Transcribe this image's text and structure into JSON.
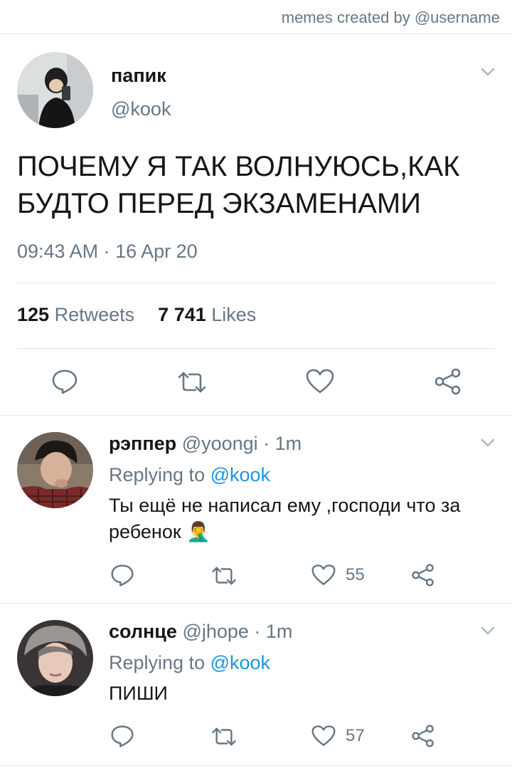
{
  "credit": "memes created by @username",
  "main_tweet": {
    "name": "папик",
    "handle": "@kook",
    "text": "ПОЧЕМУ Я ТАК ВОЛНУЮСЬ,КАК БУДТО ПЕРЕД ЭКЗАМЕНАМИ",
    "timestamp": "09:43 AM · 16 Apr 20",
    "retweets_count": "125",
    "retweets_label": "Retweets",
    "likes_count": "7 741",
    "likes_label": "Likes",
    "icons": [
      "reply-icon",
      "retweet-icon",
      "like-icon",
      "share-icon",
      "chevron-down-icon"
    ]
  },
  "replies": [
    {
      "name": "рэппер",
      "handle_time": "@yoongi · 1m",
      "replying_prefix": "Replying to",
      "replying_to": "@kook",
      "text": "Ты ещё не написал ему ,господи что за ребенок 🤦‍♂️",
      "likes": "55"
    },
    {
      "name": "солнце",
      "handle_time": "@jhope · 1m",
      "replying_prefix": "Replying to",
      "replying_to": "@kook",
      "text": "ПИШИ",
      "likes": "57"
    }
  ],
  "colors": {
    "text": "#14171a",
    "muted": "#657786",
    "link": "#1b95e0",
    "divider": "#e1e8ed"
  }
}
